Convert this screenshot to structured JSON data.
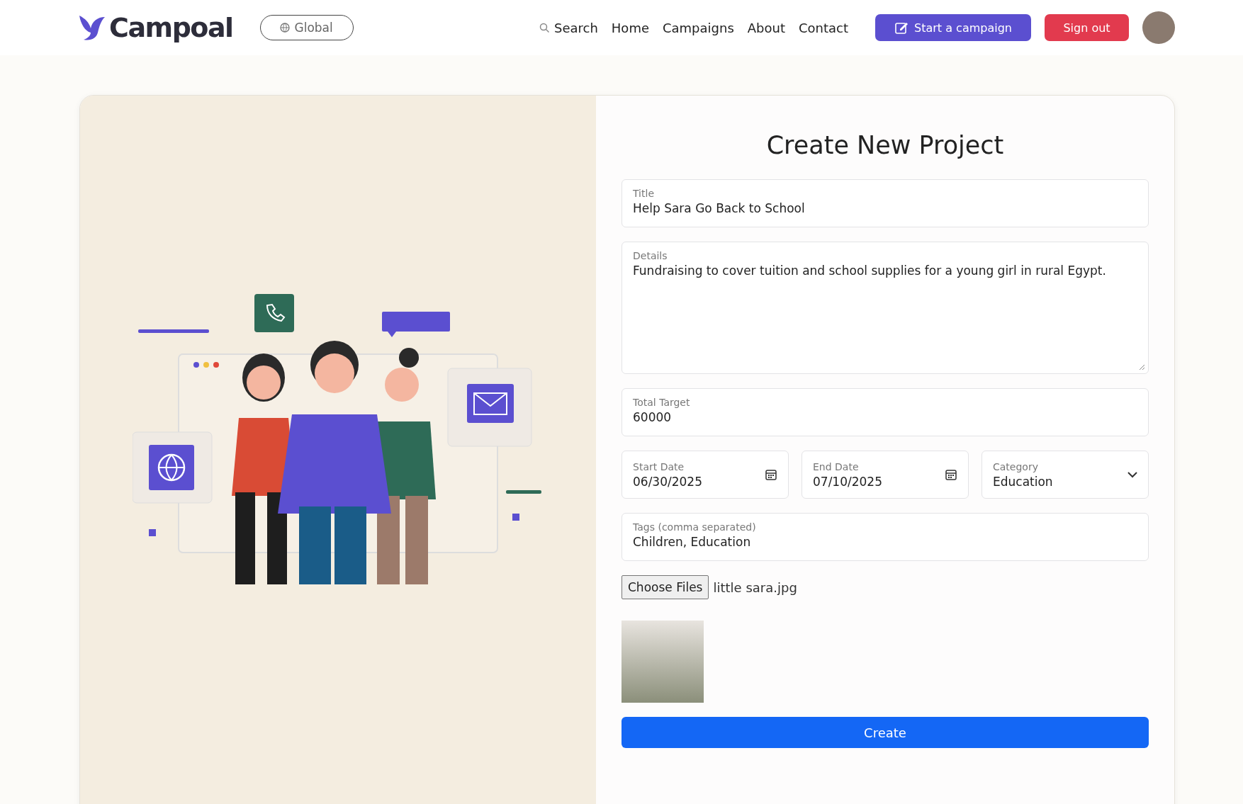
{
  "header": {
    "logo": "Campoal",
    "region_button": "Global",
    "nav": [
      "Search",
      "Home",
      "Campaigns",
      "About",
      "Contact"
    ],
    "start_button": "Start a campaign",
    "signout_button": "Sign out"
  },
  "form": {
    "heading": "Create New Project",
    "fields": [
      {
        "kind": "input",
        "label": "Title",
        "value": "Help Sara Go Back to School"
      },
      {
        "kind": "textarea",
        "label": "Details",
        "value": "Fundraising to cover tuition and school supplies for a young girl in rural Egypt."
      },
      {
        "kind": "input",
        "label": "Total Target",
        "value": "60000"
      }
    ],
    "row": [
      {
        "kind": "date",
        "label": "Start Date",
        "value": "06/30/2025"
      },
      {
        "kind": "date",
        "label": "End Date",
        "value": "07/10/2025"
      },
      {
        "kind": "select",
        "label": "Category",
        "value": "Education"
      }
    ],
    "tags": {
      "label": "Tags (comma separated)",
      "value": "Children, Education"
    },
    "file": {
      "button": "Choose Files",
      "name": "little sara.jpg"
    },
    "submit": "Create"
  }
}
